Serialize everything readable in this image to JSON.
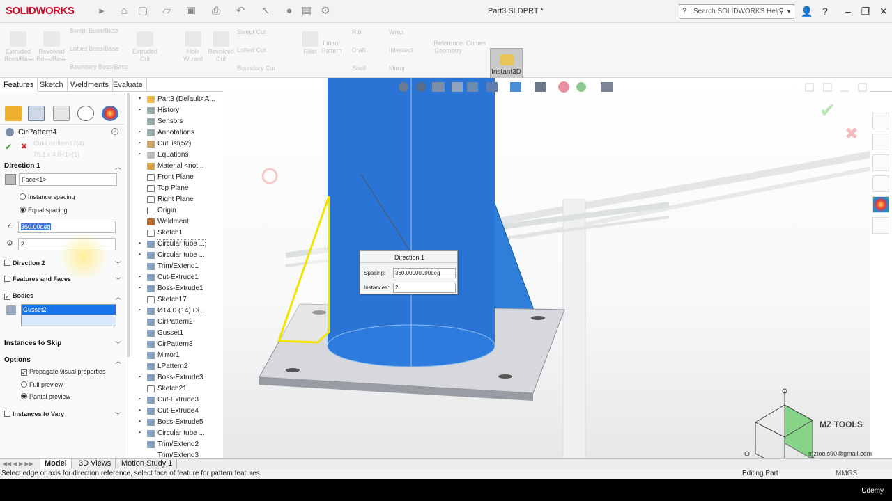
{
  "app": {
    "logo": "SOLIDWORKS",
    "doc_title": "Part3.SLDPRT *"
  },
  "search": {
    "placeholder": "Search SOLIDWORKS Help"
  },
  "ribbon": {
    "items": [
      "Extruded Boss/Base",
      "Revolved Boss/Base",
      "Swept Boss/Base",
      "Lofted Boss/Base",
      "Boundary Boss/Base",
      "Extruded Cut",
      "Hole Wizard",
      "Revolved Cut",
      "Swept Cut",
      "Lofted Cut",
      "Boundary Cut",
      "Fillet",
      "Linear Pattern",
      "Rib",
      "Draft",
      "Shell",
      "Wrap",
      "Intersect",
      "Mirror",
      "Reference Geometry",
      "Curves"
    ],
    "instant3d": "Instant3D"
  },
  "tabs": [
    "Features",
    "Sketch",
    "Weldments",
    "Evaluate"
  ],
  "property_manager": {
    "title": "CirPattern4",
    "direction1": {
      "header": "Direction 1",
      "axis_value": "Face<1>",
      "instance_spacing": "Instance spacing",
      "equal_spacing": "Equal spacing",
      "angle_value": "360.00deg",
      "instances_value": "2"
    },
    "direction2": "Direction 2",
    "features_and_faces": "Features and Faces",
    "bodies": {
      "header": "Bodies",
      "selected": "Gusset2"
    },
    "instances_to_skip": "Instances to Skip",
    "options": {
      "header": "Options",
      "propagate": "Propagate visual properties",
      "full_preview": "Full preview",
      "partial_preview": "Partial preview"
    },
    "instances_to_vary": "Instances to Vary"
  },
  "tree": {
    "root": "Part3  (Default<A...",
    "items": [
      "History",
      "Sensors",
      "Annotations",
      "Cut list(52)",
      "Equations",
      "Material <not...",
      "Front Plane",
      "Top Plane",
      "Right Plane",
      "Origin",
      "Weldment",
      "Sketch1",
      "Circular tube ...",
      "Circular tube ...",
      "Trim/Extend1",
      "Cut-Extrude1",
      "Boss-Extrude1",
      "Sketch17",
      "Ø14.0 (14) Di...",
      "CirPattern2",
      "Gusset1",
      "CirPattern3",
      "Mirror1",
      "LPattern2",
      "Boss-Extrude3",
      "Sketch21",
      "Cut-Extrude3",
      "Cut-Extrude4",
      "Boss-Extrude5",
      "Circular tube ...",
      "Trim/Extend2",
      "Trim/Extend3"
    ]
  },
  "dialog": {
    "title": "Direction 1",
    "spacing_label": "Spacing:",
    "spacing_value": "360.00000000deg",
    "instances_label": "Instances:",
    "instances_value": "2"
  },
  "bottom_tabs": [
    "Model",
    "3D Views",
    "Motion Study 1"
  ],
  "status": {
    "message": "Select edge or axis for direction reference, select face of feature for pattern features",
    "mode": "Editing Part",
    "units": "MMGS"
  },
  "watermark": {
    "brand": "MZ TOOLS",
    "email": "mztools90@gmail.com",
    "udemy": "Udemy"
  },
  "colors": {
    "accent": "#1f6fd1",
    "gusset": "#f0e000",
    "selection": "#1a73e8"
  }
}
